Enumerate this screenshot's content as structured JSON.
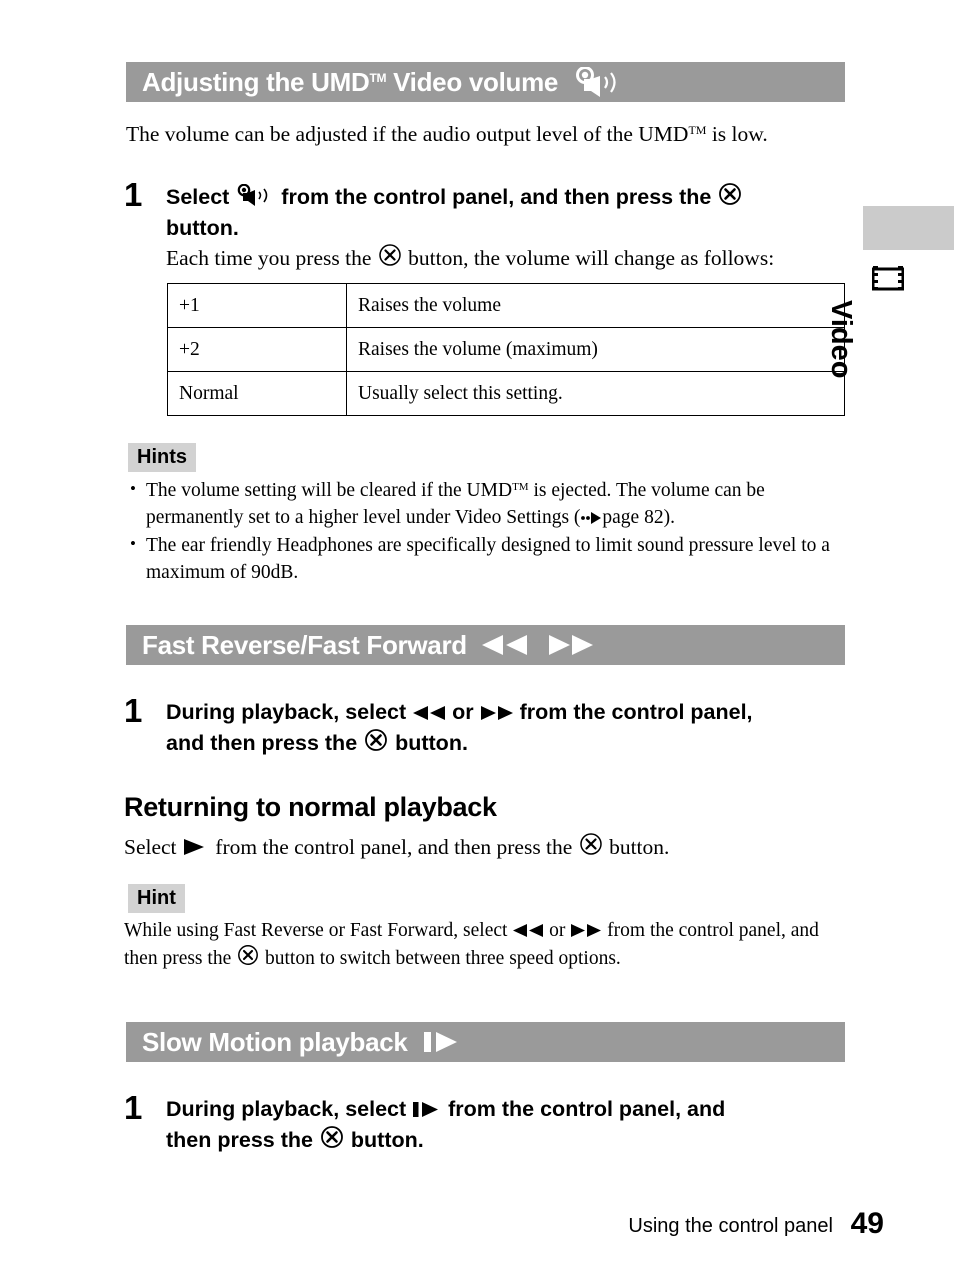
{
  "document": {
    "page_number": "49",
    "footer_text": "Using the control panel",
    "side_tab_label": "Video",
    "side_tab_icon": "film-strip-icon"
  },
  "sections": [
    {
      "id": "volume",
      "band_title": "Adjusting the UMD™ Video volume",
      "band_title_main": "Adjusting the UMD",
      "band_title_tm": "TM",
      "band_title_tail": " Video volume",
      "band_icons": [
        "speaker-volume-icon"
      ],
      "intro_lead": "The volume can be adjusted if the audio output level of the UMD",
      "intro_tm": "TM",
      "intro_tail": " is low.",
      "step_number": "1",
      "step_line1_a": "Select ",
      "step_line1_icon": "speaker-volume-icon",
      "step_line1_b": " from the control panel, and then press the ",
      "step_line1_icon2": "cross-button-icon",
      "step_line2": "button.",
      "step_sub_a": "Each time you press the ",
      "step_sub_icon": "cross-button-icon",
      "step_sub_b": " button, the volume will change as follows:",
      "table": {
        "rows": [
          {
            "setting": "+1",
            "description": "Raises the volume"
          },
          {
            "setting": "+2",
            "description": "Raises the volume (maximum)"
          },
          {
            "setting": "Normal",
            "description": "Usually select this setting."
          }
        ]
      },
      "hints_badge": "Hints",
      "hints": [
        {
          "a": "The volume setting will be cleared if the UMD",
          "tm": "TM",
          "b": " is ejected. The volume can be permanently set to a higher level under Video Settings (",
          "icon": "page-reference-arrow-icon",
          "c": "page 82)."
        },
        {
          "a": "The ear friendly Headphones are specifically designed to limit sound pressure level to a maximum of 90dB.",
          "tm": "",
          "b": "",
          "icon": "",
          "c": ""
        }
      ]
    },
    {
      "id": "fast-reverse-forward",
      "band_title": "Fast Reverse/Fast Forward",
      "band_icons": [
        "fast-reverse-icon",
        "fast-forward-icon"
      ],
      "step_number": "1",
      "step_line1_a": "During playback, select ",
      "step_line1_icon": "fast-reverse-icon",
      "step_line1_mid": " or ",
      "step_line1_icon2": "fast-forward-icon",
      "step_line1_b": " from the control panel,",
      "step_line2_a": "and then press the ",
      "step_line2_icon": "cross-button-icon",
      "step_line2_b": " button.",
      "subhead": "Returning to normal playback",
      "sub_para_a": "Select ",
      "sub_para_icon": "play-icon",
      "sub_para_b": " from the control panel, and then press the ",
      "sub_para_icon2": "cross-button-icon",
      "sub_para_c": " button.",
      "hint_badge": "Hint",
      "hint_a": "While using Fast Reverse or Fast Forward, select ",
      "hint_icon": "fast-reverse-icon",
      "hint_mid": " or ",
      "hint_icon2": "fast-forward-icon",
      "hint_b": "  from the control panel, and then press the ",
      "hint_icon3": "cross-button-icon",
      "hint_c": " button to switch between three speed options."
    },
    {
      "id": "slow-motion",
      "band_title": "Slow Motion playback",
      "band_icons": [
        "slow-motion-icon"
      ],
      "step_number": "1",
      "step_line1_a": "During playback, select ",
      "step_line1_icon": "slow-motion-icon",
      "step_line1_b": " from the control panel, and",
      "step_line2_a": "then press the ",
      "step_line2_icon": "cross-button-icon",
      "step_line2_b": " button."
    }
  ],
  "colors": {
    "band_gray": "#9a9a9a",
    "badge_gray": "#d2d2d2",
    "tab_gray": "#cbcbcb",
    "text": "#000000",
    "band_text": "#ffffff"
  }
}
